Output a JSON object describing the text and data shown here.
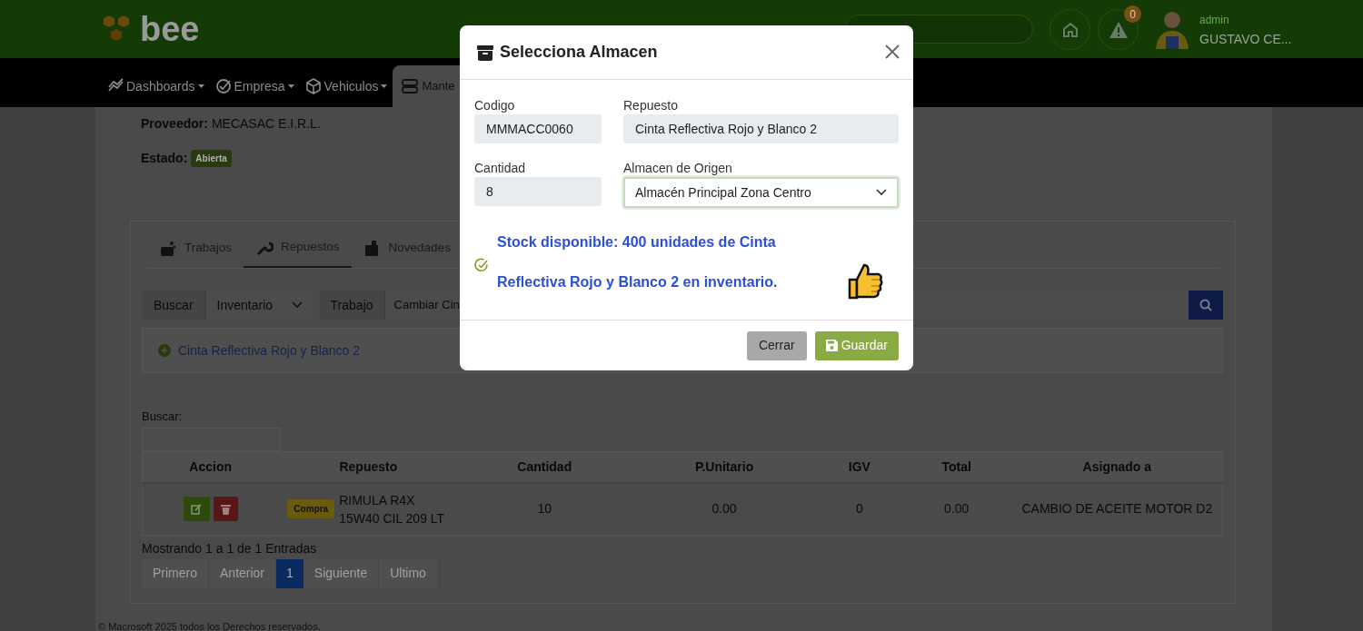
{
  "header": {
    "logo": "bee",
    "notification_count": "0",
    "user_role": "admin",
    "user_name": "GUSTAVO CE..."
  },
  "nav": [
    {
      "label": "Dashboards",
      "selected": false
    },
    {
      "label": "Empresa",
      "selected": false
    },
    {
      "label": "Vehiculos",
      "selected": false
    },
    {
      "label": "Mante",
      "selected": true
    }
  ],
  "order": {
    "provider_label": "Proveedor:",
    "provider": "MECASAC E.I.R.L.",
    "status_label": "Estado:",
    "status": "Abierta"
  },
  "tabs": [
    {
      "label": "Trabajos",
      "selected": false
    },
    {
      "label": "Repuestos",
      "selected": true
    },
    {
      "label": "Novedades",
      "selected": false
    }
  ],
  "search_bar": {
    "addon_1": "Buscar",
    "select": "Inventario",
    "addon_2": "Trabajo",
    "value": "Cambiar Cin"
  },
  "results": [
    "Cinta Reflectiva Rojo y Blanco 2"
  ],
  "table": {
    "search_label": "Buscar:",
    "columns": [
      "Accion",
      "Repuesto",
      "Cantidad",
      "P.Unitario",
      "IGV",
      "Total",
      "Asignado a"
    ],
    "rows": [
      {
        "tag": "Compra",
        "repuesto": "RIMULA R4X 15W40 CIL 209 LT",
        "cantidad": "10",
        "p_unitario": "0.00",
        "igv": "0",
        "total": "0.00",
        "asignado": "CAMBIO DE ACEITE MOTOR D2"
      }
    ]
  },
  "pagination": {
    "info": "Mostrando 1 a 1 de 1 Entradas",
    "pages": [
      {
        "label": "Primero",
        "selected": false
      },
      {
        "label": "Anterior",
        "selected": false
      },
      {
        "label": "1",
        "selected": true
      },
      {
        "label": "Siguiente",
        "selected": false
      },
      {
        "label": "Ultimo",
        "selected": false
      }
    ]
  },
  "footer": "© Macrosoft 2025 todos los Derechos reservados.",
  "modal": {
    "title": "Selecciona Almacen",
    "fields": [
      {
        "label": "Codigo",
        "value": "MMMACC0060",
        "kind": "input"
      },
      {
        "label": "Repuesto",
        "value": "Cinta Reflectiva Rojo y Blanco 2",
        "kind": "input"
      },
      {
        "label": "Cantidad",
        "value": "8",
        "kind": "input"
      },
      {
        "label": "Almacen de Origen",
        "value": "Almacén Principal Zona Centro",
        "kind": "select"
      }
    ],
    "message": "Stock disponible: 400 unidades de Cinta Reflectiva Rojo y Blanco 2 en inventario.",
    "buttons": [
      {
        "label": "Cerrar",
        "kind": "secondary"
      },
      {
        "label": "Guardar",
        "kind": "primary"
      }
    ]
  }
}
